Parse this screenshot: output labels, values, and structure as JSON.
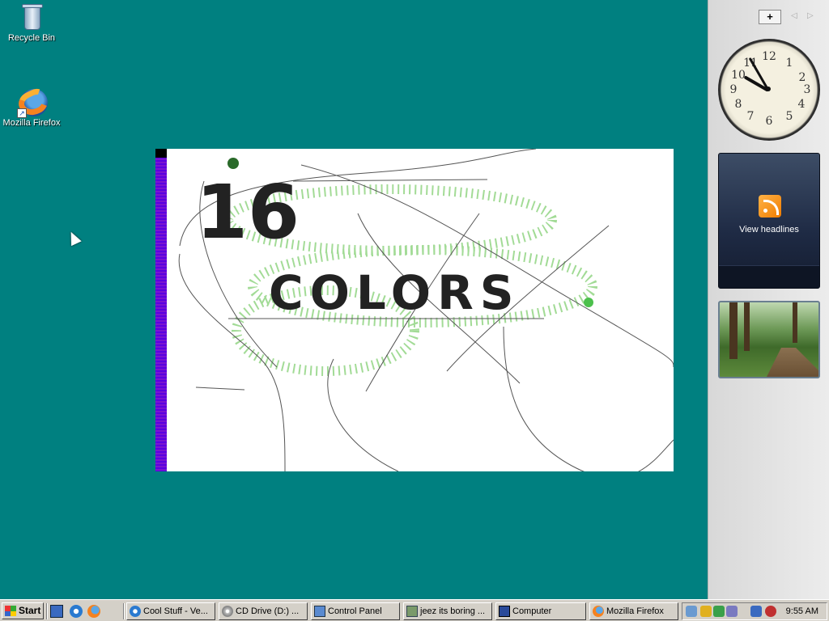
{
  "desktop": {
    "icons": [
      {
        "label": "Recycle Bin",
        "icon": "recycle-bin-icon"
      },
      {
        "label": "Mozilla Firefox",
        "icon": "firefox-icon"
      }
    ],
    "background_color": "#008080"
  },
  "painting": {
    "big_text": "16",
    "small_text": "COLORS",
    "strip_color": "#5a00e0"
  },
  "sidebar": {
    "add_label": "+",
    "prev_label": "◁",
    "next_label": "▷",
    "clock_numbers": [
      "12",
      "1",
      "2",
      "3",
      "4",
      "5",
      "6",
      "7",
      "8",
      "9",
      "10",
      "11"
    ],
    "news_label": "View headlines"
  },
  "taskbar": {
    "start_label": "Start",
    "tasks": [
      {
        "label": "Cool Stuff - Ve...",
        "icon": "ie-icon"
      },
      {
        "label": "CD Drive (D:) ...",
        "icon": "cd-drive-icon"
      },
      {
        "label": "Control Panel",
        "icon": "control-panel-icon"
      },
      {
        "label": "jeez its boring ...",
        "icon": "image-icon"
      },
      {
        "label": "Computer",
        "icon": "computer-icon"
      },
      {
        "label": "Mozilla Firefox",
        "icon": "firefox-icon"
      }
    ],
    "time": "9:55 AM"
  }
}
